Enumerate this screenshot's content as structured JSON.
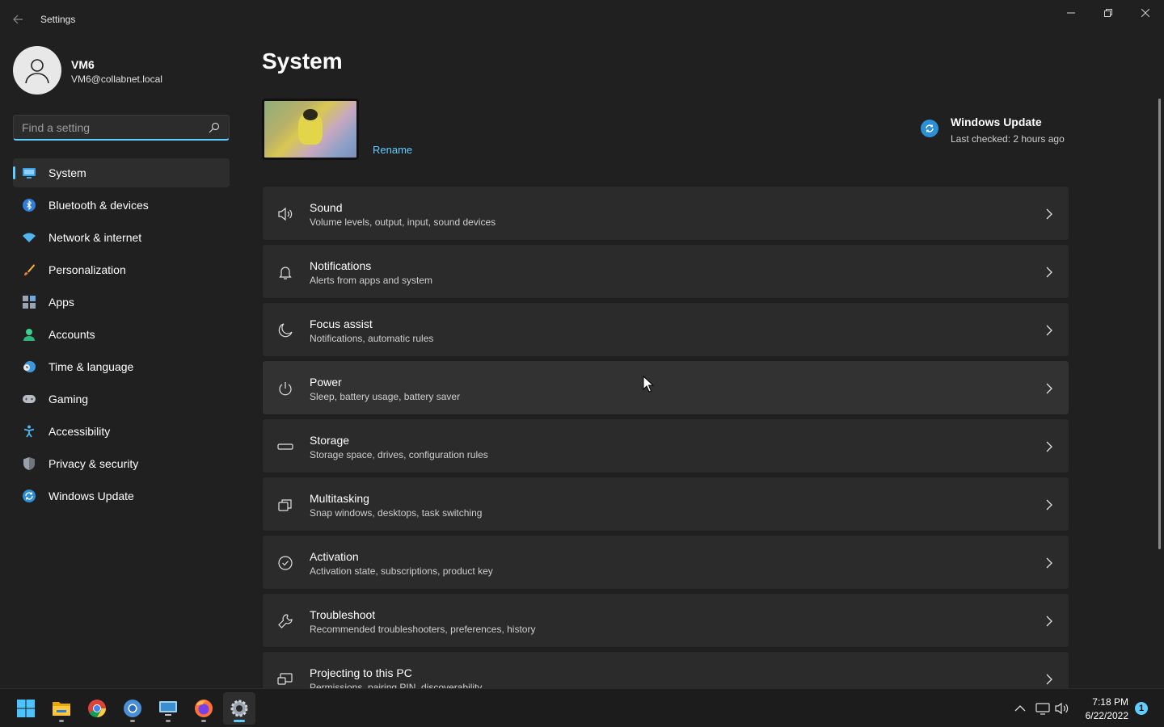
{
  "window": {
    "title": "Settings",
    "back_icon": "arrow-left-icon",
    "minimize_icon": "minimize-icon",
    "maximize_icon": "restore-icon",
    "close_icon": "close-icon"
  },
  "user": {
    "name": "VM6",
    "email": "VM6@collabnet.local",
    "avatar_icon": "person-icon"
  },
  "search": {
    "placeholder": "Find a setting",
    "value": ""
  },
  "sidebar": {
    "items": [
      {
        "label": "System",
        "icon": "monitor-icon",
        "active": true
      },
      {
        "label": "Bluetooth & devices",
        "icon": "bluetooth-icon"
      },
      {
        "label": "Network & internet",
        "icon": "wifi-icon"
      },
      {
        "label": "Personalization",
        "icon": "brush-icon"
      },
      {
        "label": "Apps",
        "icon": "apps-icon"
      },
      {
        "label": "Accounts",
        "icon": "person-icon"
      },
      {
        "label": "Time & language",
        "icon": "globe-clock-icon"
      },
      {
        "label": "Gaming",
        "icon": "gamepad-icon"
      },
      {
        "label": "Accessibility",
        "icon": "accessibility-icon"
      },
      {
        "label": "Privacy & security",
        "icon": "shield-icon"
      },
      {
        "label": "Windows Update",
        "icon": "update-icon"
      }
    ]
  },
  "main": {
    "title": "System",
    "rename_label": "Rename",
    "windows_update": {
      "title": "Windows Update",
      "subtitle": "Last checked: 2 hours ago"
    },
    "cards": [
      {
        "title": "Sound",
        "subtitle": "Volume levels, output, input, sound devices",
        "icon": "speaker-icon"
      },
      {
        "title": "Notifications",
        "subtitle": "Alerts from apps and system",
        "icon": "bell-icon"
      },
      {
        "title": "Focus assist",
        "subtitle": "Notifications, automatic rules",
        "icon": "moon-icon"
      },
      {
        "title": "Power",
        "subtitle": "Sleep, battery usage, battery saver",
        "icon": "power-icon"
      },
      {
        "title": "Storage",
        "subtitle": "Storage space, drives, configuration rules",
        "icon": "drive-icon"
      },
      {
        "title": "Multitasking",
        "subtitle": "Snap windows, desktops, task switching",
        "icon": "multitasking-icon"
      },
      {
        "title": "Activation",
        "subtitle": "Activation state, subscriptions, product key",
        "icon": "check-circle-icon"
      },
      {
        "title": "Troubleshoot",
        "subtitle": "Recommended troubleshooters, preferences, history",
        "icon": "wrench-icon"
      },
      {
        "title": "Projecting to this PC",
        "subtitle": "Permissions, pairing PIN, discoverability",
        "icon": "projecting-icon"
      }
    ]
  },
  "taskbar": {
    "apps": [
      "windows-start-icon",
      "file-explorer-icon",
      "chrome-icon",
      "chrome-alt-icon",
      "remote-desktop-icon",
      "firefox-icon",
      "settings-icon"
    ],
    "time": "7:18 PM",
    "date": "6/22/2022",
    "notification_count": "1"
  },
  "colors": {
    "accent": "#60cdff",
    "background": "#202020",
    "card": "#2b2b2b"
  }
}
